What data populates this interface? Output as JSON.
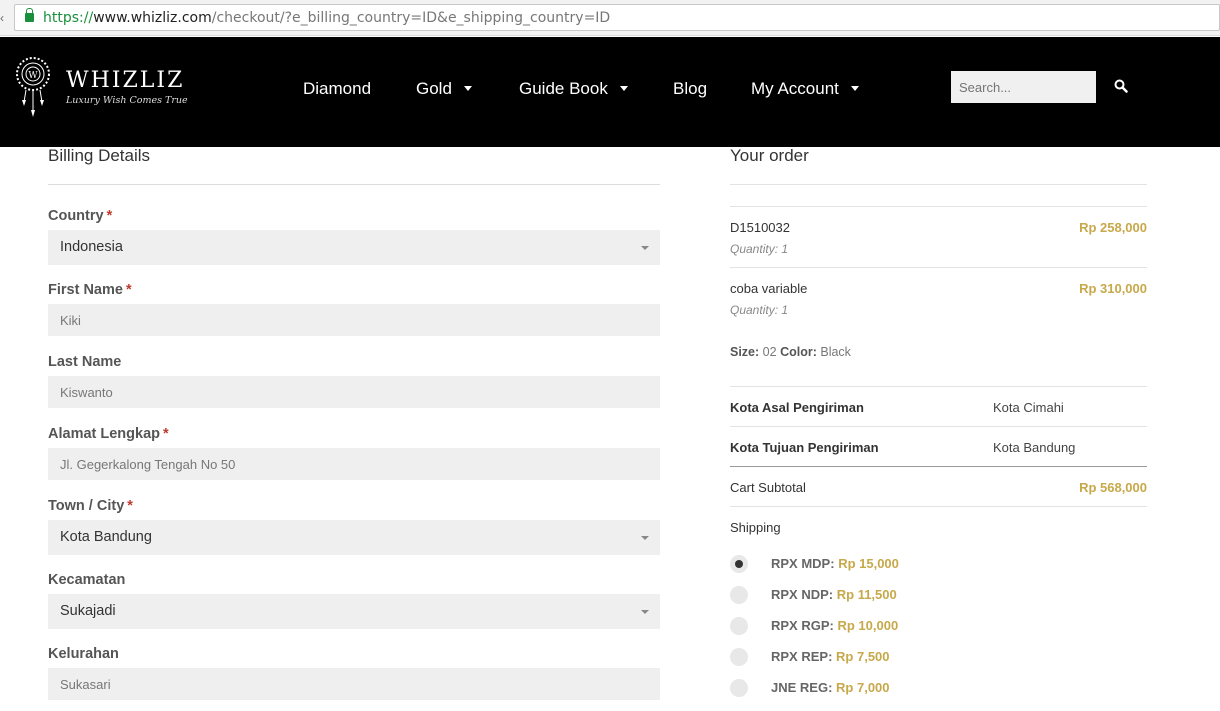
{
  "browser": {
    "url_scheme": "https://",
    "url_host": "www.whizliz.com",
    "url_path": "/checkout/?e_billing_country=ID&e_shipping_country=ID"
  },
  "header": {
    "logo_name": "WHIZLIZ",
    "logo_tagline": "Luxury Wish Comes True",
    "nav": [
      {
        "label": "Diamond",
        "has_dropdown": false
      },
      {
        "label": "Gold",
        "has_dropdown": true
      },
      {
        "label": "Guide Book",
        "has_dropdown": true
      },
      {
        "label": "Blog",
        "has_dropdown": false
      },
      {
        "label": "My Account",
        "has_dropdown": true
      }
    ],
    "search_placeholder": "Search...",
    "search_icon": "search-icon"
  },
  "billing": {
    "title": "Billing Details",
    "fields": [
      {
        "label": "Country",
        "required": true,
        "type": "select",
        "value": "Indonesia"
      },
      {
        "label": "First Name",
        "required": true,
        "type": "text",
        "value": "Kiki"
      },
      {
        "label": "Last Name",
        "required": false,
        "type": "text",
        "value": "Kiswanto"
      },
      {
        "label": "Alamat Lengkap",
        "required": true,
        "type": "text",
        "value": "Jl. Gegerkalong Tengah No 50"
      },
      {
        "label": "Town / City",
        "required": true,
        "type": "select",
        "value": "Kota Bandung"
      },
      {
        "label": "Kecamatan",
        "required": false,
        "type": "select",
        "value": "Sukajadi"
      },
      {
        "label": "Kelurahan",
        "required": false,
        "type": "text",
        "value": "Sukasari"
      }
    ],
    "required_mark": "*"
  },
  "order": {
    "title": "Your order",
    "items": [
      {
        "name": "D1510032",
        "quantity": "Quantity: 1",
        "price": "Rp 258,000"
      },
      {
        "name": "coba variable",
        "quantity": "Quantity: 1",
        "price": "Rp 310,000",
        "size_label": "Size:",
        "size_value": "02",
        "color_label": "Color:",
        "color_value": "Black"
      }
    ],
    "origin_label": "Kota Asal Pengiriman",
    "origin_value": "Kota Cimahi",
    "destination_label": "Kota Tujuan Pengiriman",
    "destination_value": "Kota Bandung",
    "subtotal_label": "Cart Subtotal",
    "subtotal_value": "Rp 568,000",
    "shipping_label": "Shipping",
    "shipping_options": [
      {
        "name": "RPX MDP:",
        "price": "Rp 15,000",
        "selected": true
      },
      {
        "name": "RPX NDP:",
        "price": "Rp 11,500",
        "selected": false
      },
      {
        "name": "RPX RGP:",
        "price": "Rp 10,000",
        "selected": false
      },
      {
        "name": "RPX REP:",
        "price": "Rp 7,500",
        "selected": false
      },
      {
        "name": "JNE REG:",
        "price": "Rp 7,000",
        "selected": false
      }
    ]
  },
  "colors": {
    "header_bg": "#000000",
    "price_gold": "#c7a84a",
    "required_red": "#c0392b",
    "field_bg": "#efefef",
    "url_green": "#1a8f3c"
  }
}
